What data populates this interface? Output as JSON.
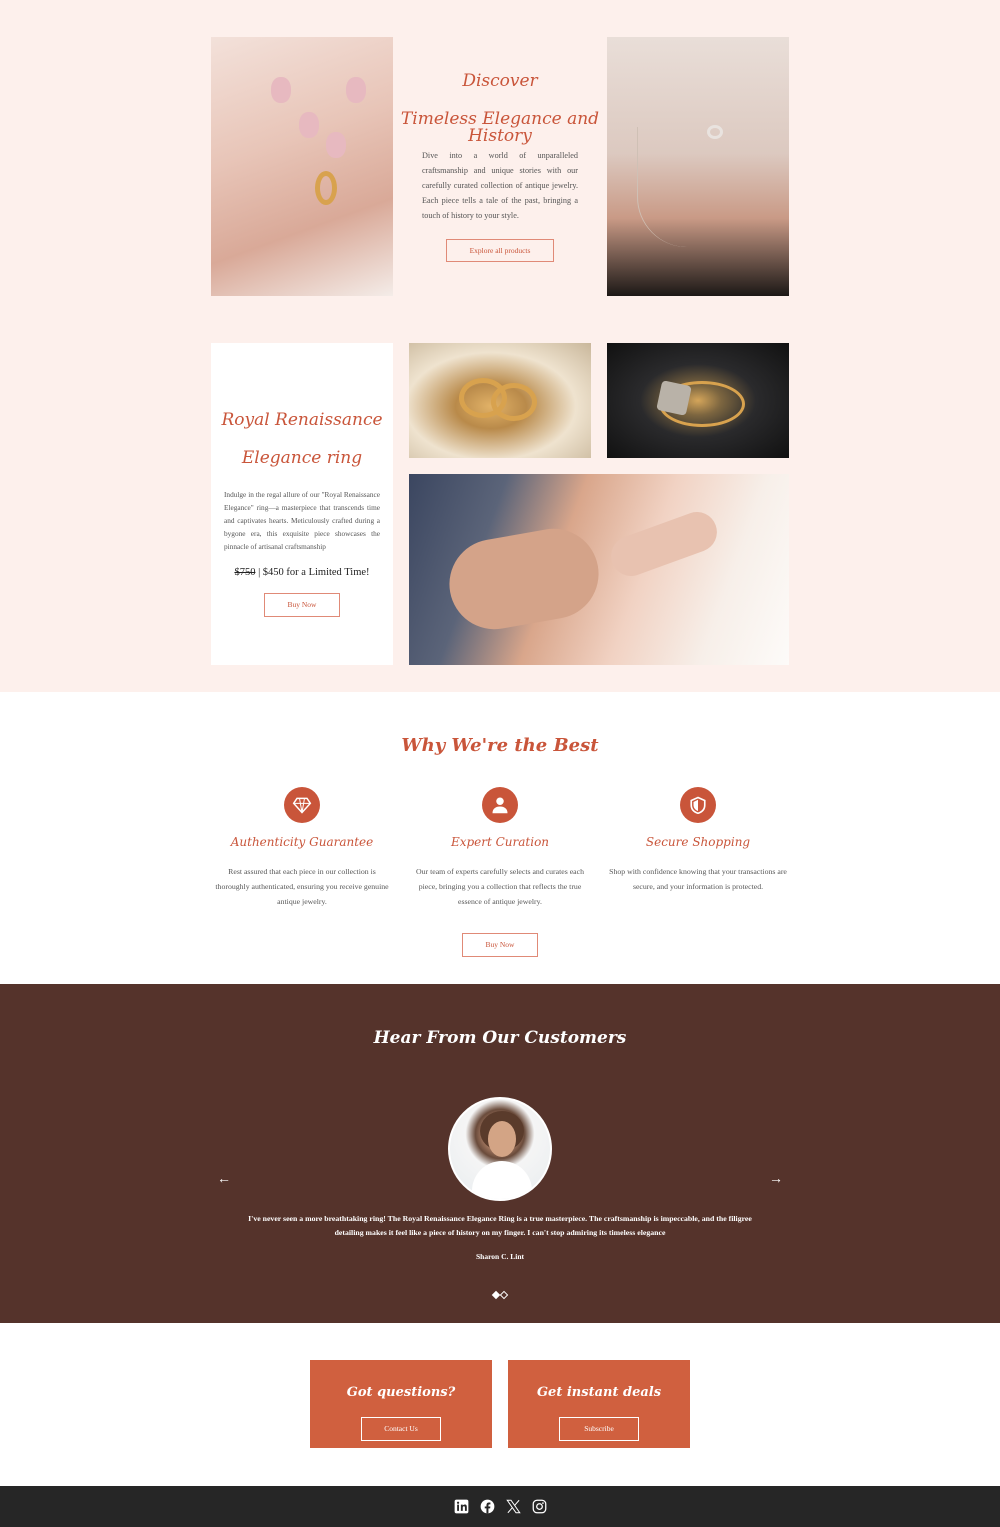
{
  "hero": {
    "title_line1": "Discover",
    "title_line2": "Timeless Elegance and History",
    "description": "Dive into a world of unparalleled craftsmanship and unique stories with our carefully curated collection of antique jewelry. Each piece tells a tale of the past, bringing a touch of history to your style.",
    "button_label": "Explore all products"
  },
  "product": {
    "title_line1": "Royal Renaissance",
    "title_line2": "Elegance ring",
    "description": "Indulge in the regal allure of our \"Royal Renaissance Elegance\" ring—a masterpiece that transcends time and captivates hearts. Meticulously crafted during a bygone era, this exquisite piece showcases the pinnacle of artisanal craftsmanship",
    "old_price": "$750",
    "price_text": " | $450 for a Limited Time!",
    "button_label": "Buy Now"
  },
  "why": {
    "title": "Why We're the Best",
    "features": [
      {
        "icon": "diamond-icon",
        "title": "Authenticity Guarantee",
        "text": "Rest assured that each piece in our collection is thoroughly authenticated, ensuring you receive genuine antique jewelry."
      },
      {
        "icon": "user-icon",
        "title": "Expert Curation",
        "text": "Our team of experts carefully selects and curates each piece, bringing you a collection that reflects the true essence of antique jewelry."
      },
      {
        "icon": "shield-icon",
        "title": "Secure Shopping",
        "text": "Shop with confidence knowing that your transactions are secure, and your information is protected."
      }
    ],
    "button_label": "Buy Now"
  },
  "testimonials": {
    "title": "Hear From Our Customers",
    "prev_arrow": "←",
    "next_arrow": "→",
    "quote": "I've never seen a more breathtaking ring! The Royal Renaissance Elegance Ring is a true masterpiece. The craftsmanship is impeccable, and the filigree detailing makes it feel like a piece of history on my finger. I can't stop admiring its timeless elegance",
    "author": "Sharon C. Lint",
    "slide_count": 2,
    "active_slide": 1
  },
  "cta": {
    "questions_title": "Got questions?",
    "questions_button": "Contact Us",
    "deals_title": "Get instant deals",
    "deals_button": "Subscribe"
  },
  "footer": {
    "social_icons": [
      "linkedin-icon",
      "facebook-icon",
      "x-icon",
      "instagram-icon"
    ]
  },
  "colors": {
    "accent": "#c9553a",
    "pink_bg": "#fdf0ec",
    "testimonial_bg": "#55332b",
    "cta_bg": "#d0603f",
    "footer_bg": "#262626"
  }
}
